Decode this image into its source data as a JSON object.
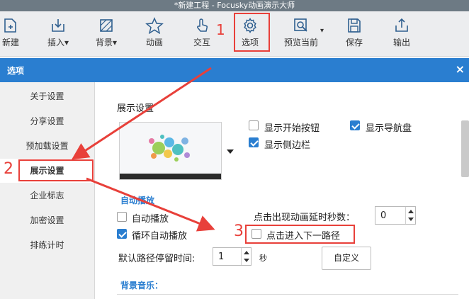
{
  "window": {
    "title": "*新建工程 - Focusky动画演示大师"
  },
  "toolbar": {
    "items": [
      {
        "label": "新建",
        "icon": "new-file-icon"
      },
      {
        "label": "插入",
        "icon": "insert-icon",
        "has_dropdown": true
      },
      {
        "label": "背景",
        "icon": "background-icon",
        "has_dropdown": true
      },
      {
        "label": "动画",
        "icon": "star-icon"
      },
      {
        "label": "交互",
        "icon": "hand-pointer-icon"
      },
      {
        "label": "选项",
        "icon": "gear-icon"
      },
      {
        "label": "预览当前",
        "icon": "preview-icon",
        "has_dropdown": true
      },
      {
        "label": "保存",
        "icon": "save-icon"
      },
      {
        "label": "输出",
        "icon": "export-icon"
      }
    ]
  },
  "annotations": {
    "step1": "1",
    "step2": "2",
    "step3": "3",
    "color": "#e8403a"
  },
  "dialog": {
    "title": "选项",
    "close": "×",
    "sidebar": {
      "items": [
        {
          "label": "关于设置"
        },
        {
          "label": "分享设置"
        },
        {
          "label": "预加载设置"
        },
        {
          "label": "展示设置",
          "active": true
        },
        {
          "label": "企业标志"
        },
        {
          "label": "加密设置"
        },
        {
          "label": "排练计时"
        }
      ]
    },
    "display": {
      "section_title": "展示设置",
      "show_start_button": {
        "label": "显示开始按钮",
        "checked": false
      },
      "show_navigator": {
        "label": "显示导航盘",
        "checked": true
      },
      "show_sidebar": {
        "label": "显示侧边栏",
        "checked": true
      }
    },
    "autoplay": {
      "section_title": "自动播放",
      "auto_play": {
        "label": "自动播放",
        "checked": false
      },
      "loop_play": {
        "label": "循环自动播放",
        "checked": true
      },
      "click_next": {
        "label": "点击进入下一路径",
        "checked": false
      },
      "delay_label": "点击出现动画延时秒数：",
      "delay_value": "0",
      "stay_label": "默认路径停留时间:",
      "stay_value": "1",
      "stay_unit": "秒",
      "custom_button": "自定义"
    },
    "music": {
      "section_title": "背景音乐："
    }
  },
  "colors": {
    "accent": "#2a7ed0",
    "annotation": "#e8403a",
    "titlebar": "#6d7a84"
  }
}
